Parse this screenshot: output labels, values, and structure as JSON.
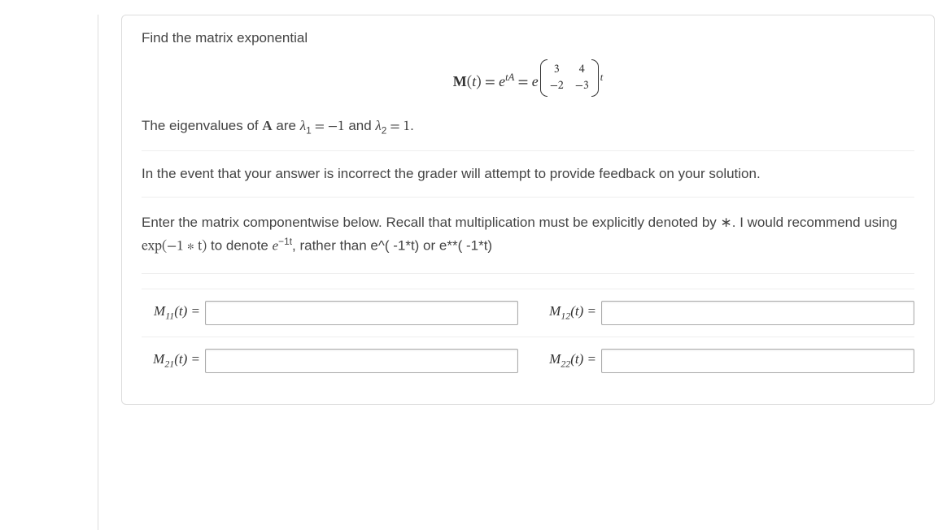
{
  "problem": {
    "intro": "Find the matrix exponential",
    "Mt_lhs": "M",
    "Mt_arg": "t",
    "eq": "=",
    "e": "e",
    "tA": "tA",
    "matrix": {
      "a11": "3",
      "a12": "4",
      "a21": "−2",
      "a22": "−3"
    },
    "post_t": "t",
    "eigen_prefix": "The eigenvalues of ",
    "A": "A",
    "eigen_mid1": " are ",
    "lambda": "λ",
    "sub1": "1",
    "eqn1": " = −1",
    "and": " and ",
    "sub2": "2",
    "eqn2": " = 1",
    "period": "."
  },
  "feedback": "In the event that your answer is incorrect the grader will attempt to provide feedback on your solution.",
  "instructions": {
    "p1": "Enter the matrix componentwise below. Recall that multiplication must be explicitly denoted by ∗. I would recommend using ",
    "exp_expr": "exp(−1 ∗ t)",
    "p2": " to denote ",
    "e": "e",
    "exp_sup": "−1t",
    "p3": ", rather than e^( -1*t) or e**( -1*t)"
  },
  "answers": {
    "m11_label": "M",
    "m11_sub": "11",
    "m12_sub": "12",
    "m21_sub": "21",
    "m22_sub": "22",
    "t_arg": "(t)",
    "eq": " ="
  }
}
